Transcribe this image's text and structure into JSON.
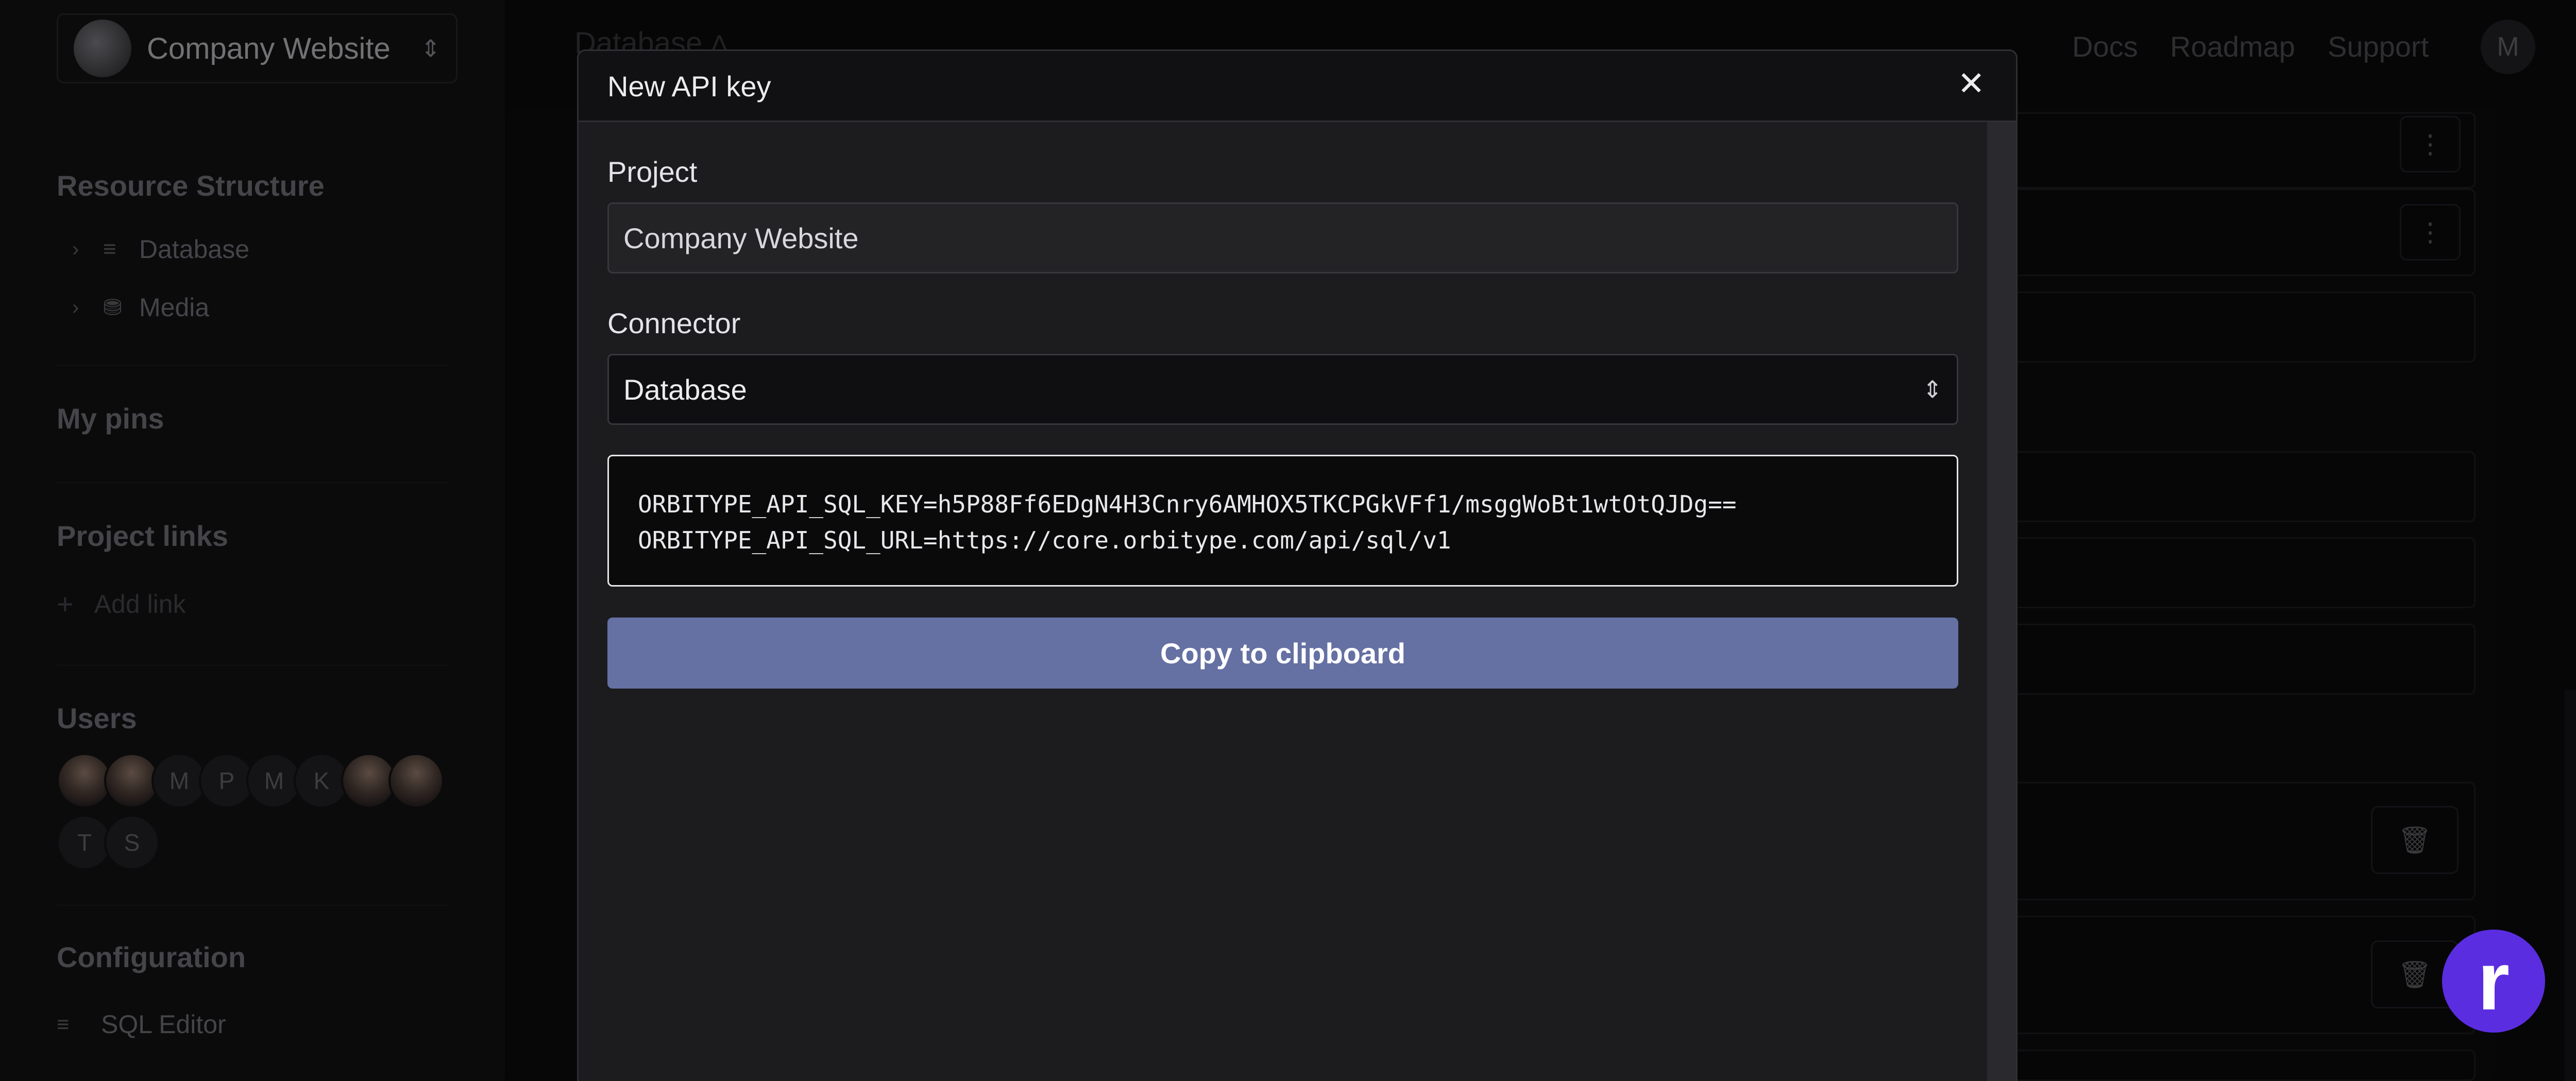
{
  "sidebar": {
    "project_switcher": {
      "name": "Company Website",
      "chevron_icon": "chevron-up-down-icon"
    },
    "resource_structure": {
      "title": "Resource Structure",
      "items": [
        {
          "label": "Database",
          "icon": "database-icon"
        },
        {
          "label": "Media",
          "icon": "bucket-icon"
        }
      ]
    },
    "pins": {
      "title": "My pins"
    },
    "project_links": {
      "title": "Project links",
      "add_label": "Add link"
    },
    "users": {
      "title": "Users",
      "avatars": [
        "",
        "",
        "M",
        "P",
        "M",
        "K",
        "",
        "",
        "T",
        "S"
      ]
    },
    "configuration": {
      "title": "Configuration",
      "items": [
        {
          "label": "SQL Editor",
          "icon": "database-icon"
        }
      ]
    }
  },
  "topbar": {
    "breadcrumb": "Database",
    "nav": [
      "Docs",
      "Roadmap",
      "Support"
    ],
    "user_initial": "M"
  },
  "modal": {
    "title": "New API key",
    "close_icon": "close-icon",
    "project": {
      "label": "Project",
      "value": "Company Website"
    },
    "connector": {
      "label": "Connector",
      "value": "Database"
    },
    "code": {
      "line1": "ORBITYPE_API_SQL_KEY=h5P88Ff6EDgN4H3Cnry6AMHOX5TKCPGkVFf1/msggWoBt1wtOtQJDg==",
      "line2": "ORBITYPE_API_SQL_URL=https://core.orbitype.com/api/sql/v1"
    },
    "copy_button": "Copy to clipboard"
  },
  "fab": {
    "label": "r"
  },
  "colors": {
    "accent": "#6570a3",
    "fab": "#5b2de0",
    "background": "#0b0b0c"
  }
}
